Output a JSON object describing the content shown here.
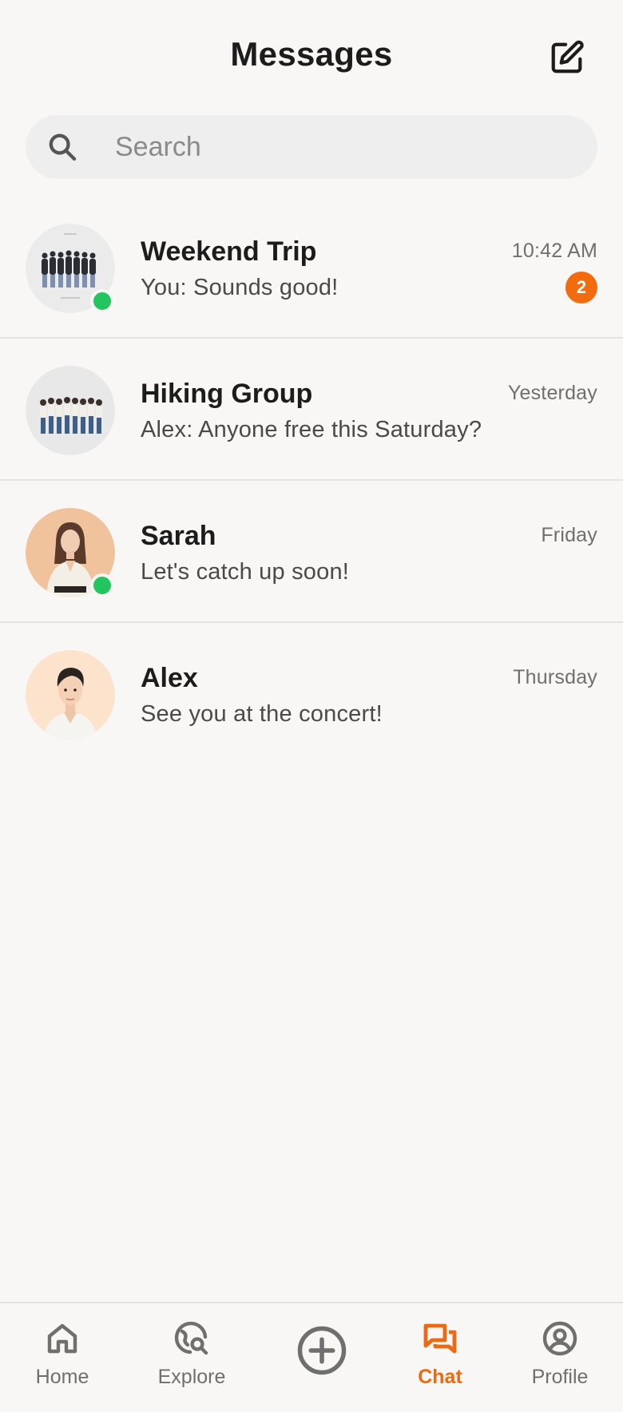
{
  "header": {
    "title": "Messages",
    "compose_icon": "compose-icon"
  },
  "search": {
    "placeholder": "Search",
    "icon": "search-icon"
  },
  "chats": [
    {
      "name": "Weekend Trip",
      "preview": "You: Sounds good!",
      "time": "10:42 AM",
      "unread": "2",
      "online": true,
      "avatar": "group-photo"
    },
    {
      "name": "Hiking Group",
      "preview": "Alex: Anyone free this Saturday?",
      "time": "Yesterday",
      "unread": null,
      "online": false,
      "avatar": "group-photo"
    },
    {
      "name": "Sarah",
      "preview": "Let's catch up soon!",
      "time": "Friday",
      "unread": null,
      "online": true,
      "avatar": "woman-portrait"
    },
    {
      "name": "Alex",
      "preview": "See you at the concert!",
      "time": "Thursday",
      "unread": null,
      "online": false,
      "avatar": "man-portrait"
    }
  ],
  "nav": {
    "items": [
      {
        "label": "Home",
        "icon": "home-icon",
        "active": false
      },
      {
        "label": "Explore",
        "icon": "explore-icon",
        "active": false
      },
      {
        "label": "",
        "icon": "add-circle-icon",
        "active": false
      },
      {
        "label": "Chat",
        "icon": "chat-icon",
        "active": true
      },
      {
        "label": "Profile",
        "icon": "profile-icon",
        "active": false
      }
    ]
  },
  "colors": {
    "accent": "#ee6a12",
    "online": "#22c55e",
    "background": "#f8f7f5",
    "search_bg": "#efeeee"
  }
}
